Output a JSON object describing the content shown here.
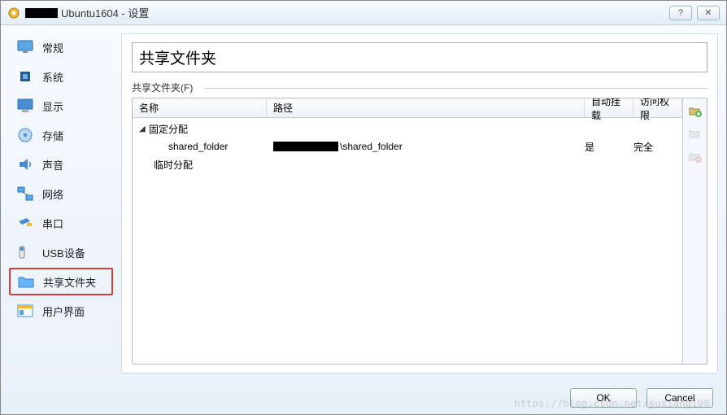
{
  "window": {
    "title": "Ubuntu1604 - 设置"
  },
  "sidebar": {
    "items": [
      {
        "label": "常规"
      },
      {
        "label": "系统"
      },
      {
        "label": "显示"
      },
      {
        "label": "存储"
      },
      {
        "label": "声音"
      },
      {
        "label": "网络"
      },
      {
        "label": "串口"
      },
      {
        "label": "USB设备"
      },
      {
        "label": "共享文件夹"
      },
      {
        "label": "用户界面"
      }
    ]
  },
  "panel": {
    "title": "共享文件夹",
    "fieldset_label": "共享文件夹(F)"
  },
  "table": {
    "headers": {
      "name": "名称",
      "path": "路径",
      "auto_mount": "自动挂载",
      "permission": "访问权限"
    },
    "groups": [
      {
        "label": "固定分配",
        "expanded": true
      },
      {
        "label": "临时分配",
        "expanded": false
      }
    ],
    "rows": [
      {
        "name": "shared_folder",
        "path_suffix": "\\shared_folder",
        "auto_mount": "是",
        "permission": "完全"
      }
    ]
  },
  "buttons": {
    "ok": "OK",
    "cancel": "Cancel"
  },
  "watermark": "https://blog.csdn.net/suxiang198"
}
